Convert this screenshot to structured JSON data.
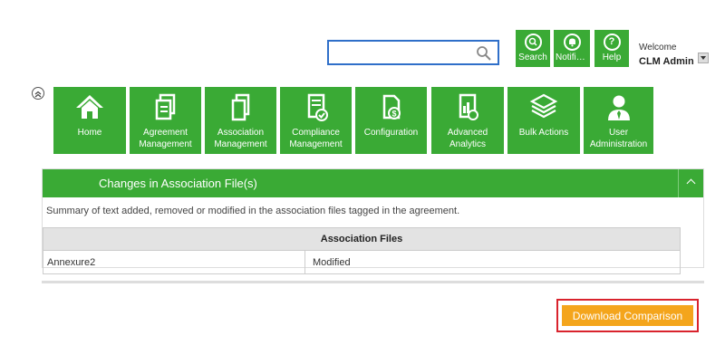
{
  "header": {
    "search": {
      "value": "",
      "placeholder": ""
    },
    "quick_actions": [
      {
        "label": "Search",
        "icon": "search-icon"
      },
      {
        "label": "Notific...",
        "icon": "bell-icon"
      },
      {
        "label": "Help",
        "icon": "help-icon"
      }
    ],
    "welcome_label": "Welcome",
    "username": "CLM Admin"
  },
  "nav": {
    "tiles": [
      {
        "label": "Home",
        "icon": "home-icon"
      },
      {
        "label": "Agreement Management",
        "icon": "documents-icon"
      },
      {
        "label": "Association Management",
        "icon": "copy-icon"
      },
      {
        "label": "Compliance Management",
        "icon": "compliance-icon"
      },
      {
        "label": "Configuration",
        "icon": "configuration-icon"
      },
      {
        "label": "Advanced Analytics",
        "icon": "analytics-icon"
      },
      {
        "label": "Bulk Actions",
        "icon": "layers-icon"
      },
      {
        "label": "User Administration",
        "icon": "user-admin-icon"
      }
    ]
  },
  "panel": {
    "title": "Changes in Association File(s)",
    "summary": "Summary of text added, removed or modified in the association files tagged in the agreement.",
    "table": {
      "header": "Association Files",
      "rows": [
        {
          "file": "Annexure2",
          "status": "Modified"
        }
      ]
    }
  },
  "actions": {
    "download_label": "Download Comparison"
  },
  "colors": {
    "brand_green": "#3aaa35",
    "download_orange": "#f4a51c",
    "highlight_red": "#d9232d",
    "search_border": "#2f6fc9"
  }
}
